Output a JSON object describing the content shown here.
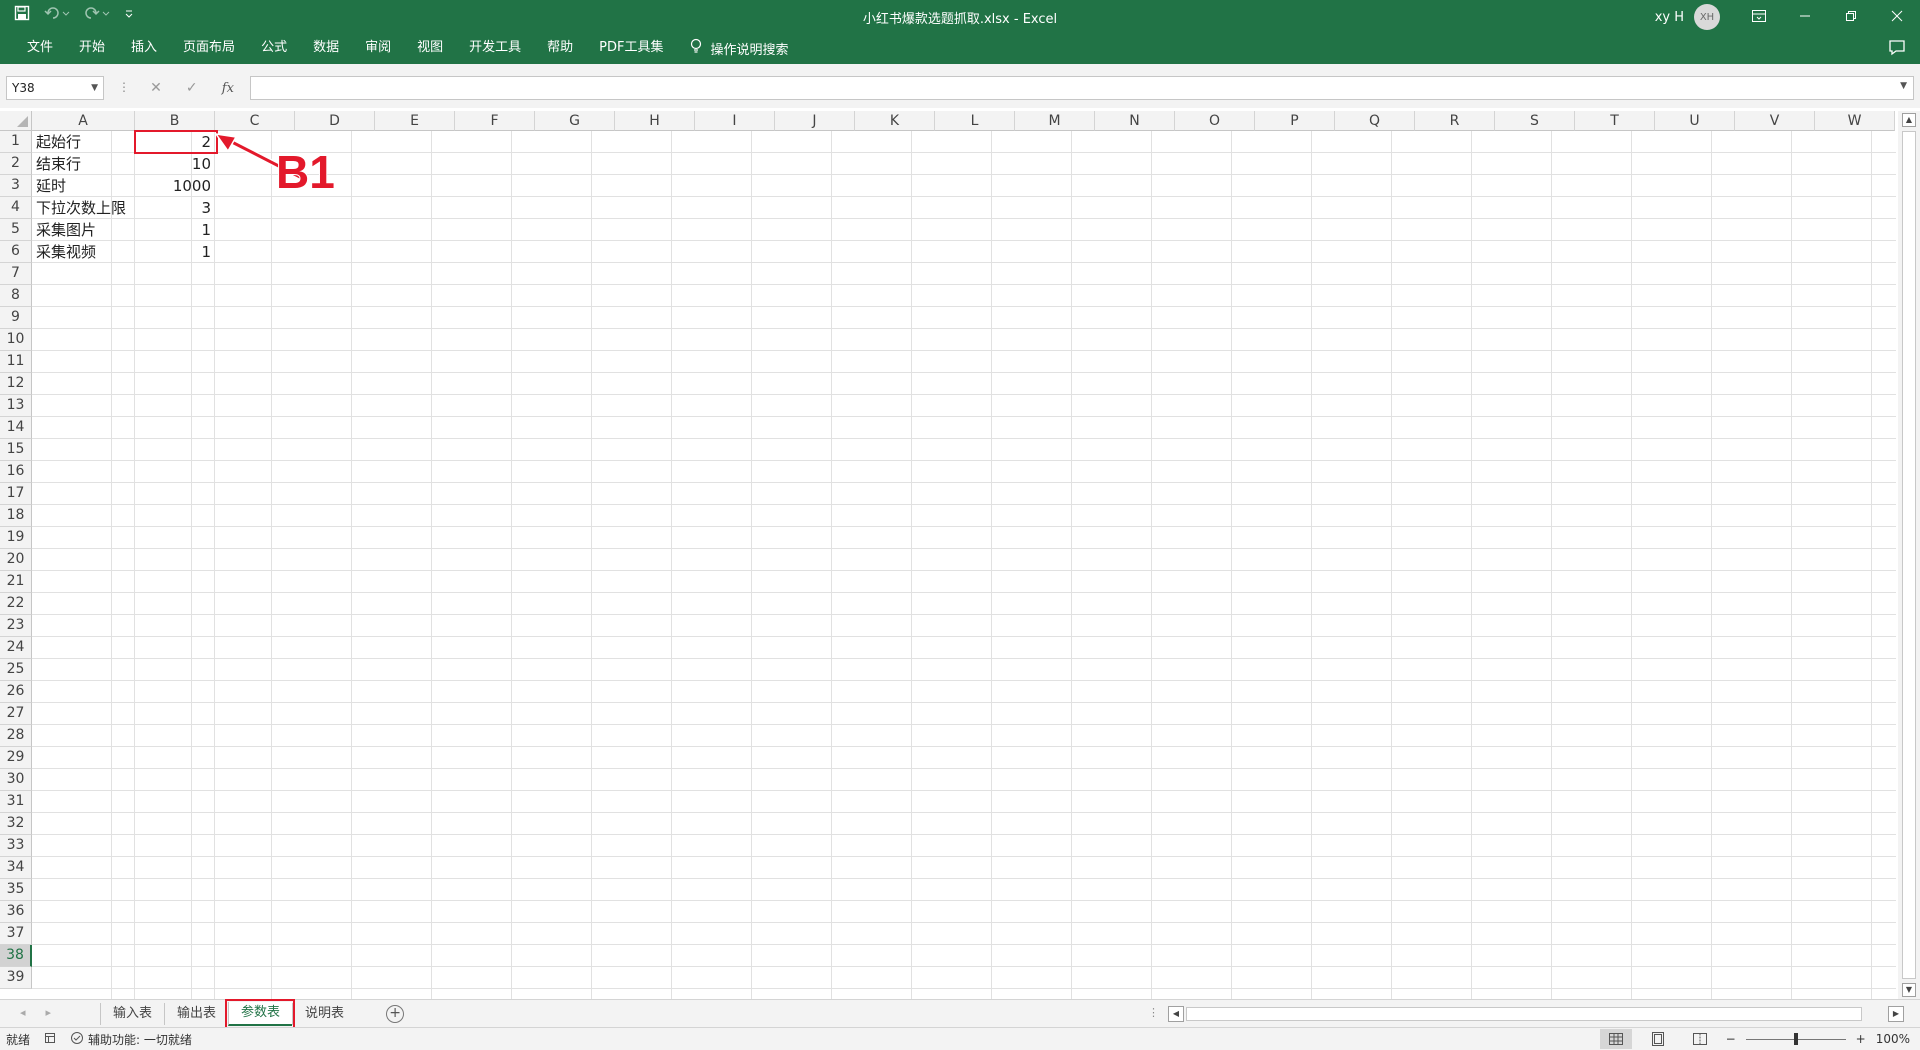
{
  "window": {
    "title": "小红书爆款选题抓取.xlsx  -  Excel",
    "user_name": "xy H",
    "user_initials": "XH"
  },
  "ribbon": {
    "tabs": [
      "文件",
      "开始",
      "插入",
      "页面布局",
      "公式",
      "数据",
      "审阅",
      "视图",
      "开发工具",
      "帮助",
      "PDF工具集"
    ],
    "tell_me": "操作说明搜索"
  },
  "formula_bar": {
    "name_box": "Y38",
    "fx_label": "fx",
    "formula": ""
  },
  "sheet": {
    "columns": [
      "A",
      "B",
      "C",
      "D",
      "E",
      "F",
      "G",
      "H",
      "I",
      "J",
      "K",
      "L",
      "M",
      "N",
      "O",
      "P",
      "Q",
      "R",
      "S",
      "T",
      "U",
      "V",
      "W"
    ],
    "row_numbers": [
      "1",
      "2",
      "3",
      "4",
      "5",
      "6",
      "7",
      "8",
      "9",
      "10",
      "11",
      "12",
      "13",
      "14",
      "15",
      "16",
      "17",
      "18",
      "19",
      "20",
      "21",
      "22",
      "23",
      "24",
      "25",
      "26",
      "27",
      "28",
      "29",
      "30",
      "31",
      "32",
      "33",
      "34",
      "35",
      "36",
      "37",
      "38",
      "39"
    ],
    "selected_row": "38",
    "rows": [
      {
        "label": "起始行",
        "value": "2"
      },
      {
        "label": "结束行",
        "value": "10"
      },
      {
        "label": "延时",
        "value": "1000"
      },
      {
        "label": "下拉次数上限",
        "value": "3"
      },
      {
        "label": "采集图片",
        "value": "1"
      },
      {
        "label": "采集视频",
        "value": "1"
      }
    ]
  },
  "annotation": {
    "label": "B1",
    "color": "#e3192b"
  },
  "sheet_tabs": {
    "tabs": [
      "输入表",
      "输出表",
      "参数表",
      "说明表"
    ],
    "active": "参数表"
  },
  "status": {
    "ready": "就绪",
    "accessibility": "辅助功能: 一切就绪",
    "zoom": "100%"
  },
  "colors": {
    "excel_green": "#217346",
    "annotation_red": "#e3192b"
  }
}
